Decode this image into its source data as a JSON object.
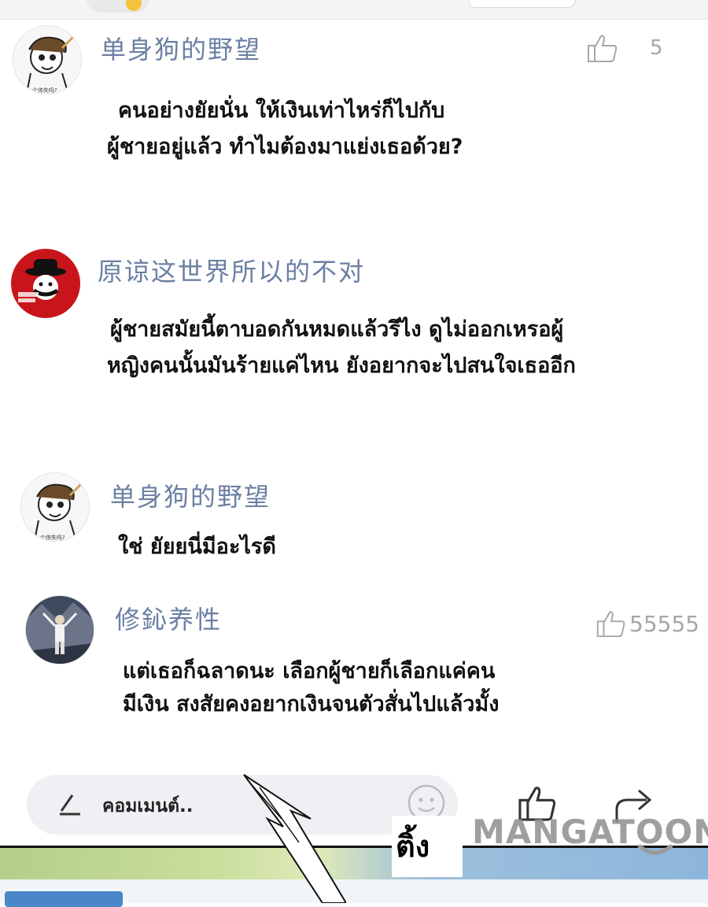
{
  "comments": [
    {
      "username": "单身狗的野望",
      "avatar_caption": "个帅失吗?",
      "lines": [
        "คนอย่างยัยนั่น ให้เงินเท่าไหร่ก็ไปกับ",
        "ผู้ชายอยู่แล้ว ทำไมต้องมาแย่งเธอด้วย?"
      ],
      "likes": "5"
    },
    {
      "username": "原谅这世界所以的不对",
      "lines": [
        "ผู้ชายสมัยนี้ตาบอดกันหมดแล้วรึไง ดูไม่ออกเหรอผู้",
        "หญิงคนนั้นมันร้ายแค่ไหน ยังอยากจะไปสนใจเธออีก"
      ]
    },
    {
      "username": "单身狗的野望",
      "avatar_caption": "个帅失吗?",
      "lines": [
        "ใช่ ยัยยนี่มีอะไรดี"
      ]
    },
    {
      "username": "修鈊养性",
      "lines": [
        "แต่เธอก็ฉลาดนะ เลือกผู้ชายก็เลือกแค่คน",
        "มีเงิน สงสัยคงอยากเงินจนตัวสั่นไปแล้วมั้ง"
      ],
      "likes": "55555"
    }
  ],
  "input": {
    "placeholder": "คอมเมนต์.."
  },
  "icons": {
    "pencil": "pencil-icon",
    "emoji": "smiley-icon",
    "like": "thumbs-up-icon",
    "share": "share-icon"
  },
  "overlay": {
    "sfx": "ติ้ง",
    "watermark": "MANGATOON"
  },
  "colors": {
    "username": "#6a7fa3",
    "text": "#111111",
    "muted": "#a7a7a7"
  }
}
